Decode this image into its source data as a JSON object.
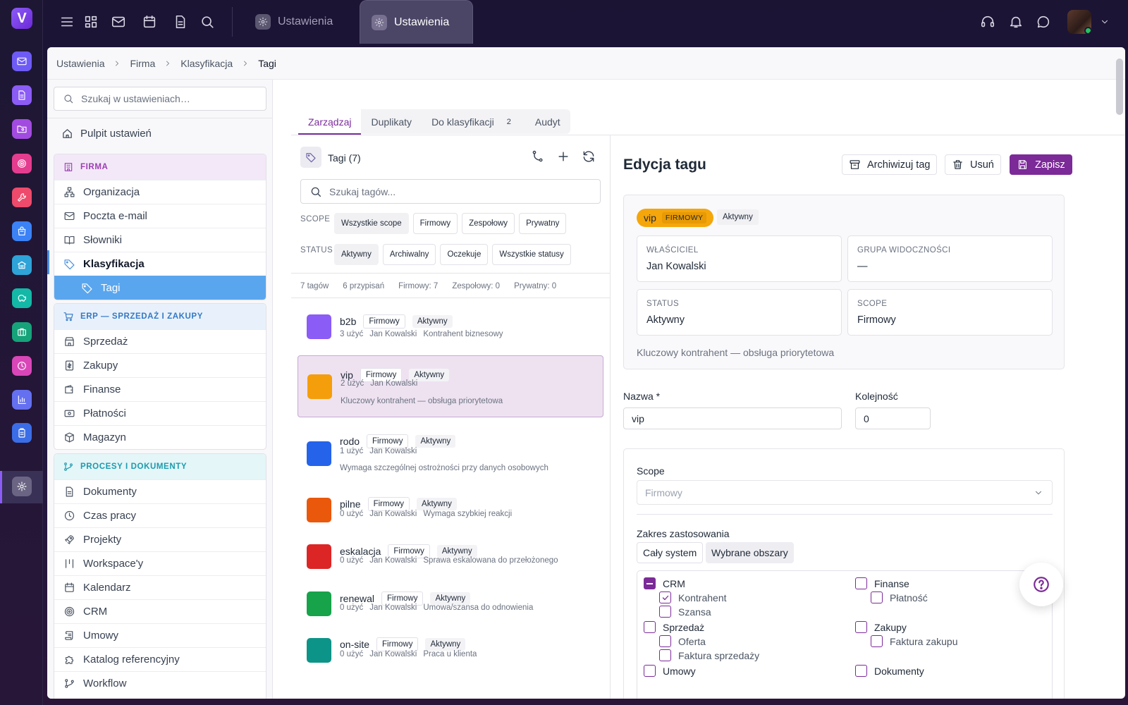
{
  "app": {
    "logo_letter": "V"
  },
  "rail": {
    "items": [
      "mail-icon",
      "document-icon",
      "folder-user-icon",
      "target-icon",
      "wrench-icon",
      "bag-icon",
      "building-icon",
      "piggy-bank-icon",
      "briefcase-icon",
      "clock-icon",
      "chart-icon",
      "clipboard-icon",
      "gear-icon"
    ],
    "colors": [
      "#6e5bf5",
      "#8b5cf6",
      "#a24be0",
      "#e43d8f",
      "#ee4a6b",
      "#3b82f6",
      "#2ea3d8",
      "#14b8a6",
      "#16a37a",
      "#d946b8",
      "#6470f0",
      "#3b6de6",
      "#6b6583"
    ]
  },
  "tabs_window": [
    {
      "label": "Ustawienia"
    },
    {
      "label": "Ustawienia"
    }
  ],
  "breadcrumb": [
    "Ustawienia",
    "Firma",
    "Klasyfikacja",
    "Tagi"
  ],
  "sidebar": {
    "search_placeholder": "Szukaj w ustawieniach…",
    "dashboard": "Pulpit ustawień",
    "groups": [
      {
        "title": "FIRMA",
        "items": [
          "Organizacja",
          "Poczta e-mail",
          "Słowniki",
          "Klasyfikacja",
          "Tagi"
        ]
      },
      {
        "title": "ERP — SPRZEDAŻ I ZAKUPY",
        "items": [
          "Sprzedaż",
          "Zakupy",
          "Finanse",
          "Płatności",
          "Magazyn"
        ]
      },
      {
        "title": "PROCESY I DOKUMENTY",
        "items": [
          "Dokumenty",
          "Czas pracy",
          "Projekty",
          "Workspace'y",
          "Kalendarz",
          "CRM",
          "Umowy",
          "Katalog referencyjny",
          "Workflow"
        ]
      }
    ]
  },
  "tabs": [
    {
      "label": "Zarządzaj"
    },
    {
      "label": "Duplikaty"
    },
    {
      "label": "Do klasyfikacji",
      "badge": "2"
    },
    {
      "label": "Audyt"
    }
  ],
  "list": {
    "title": "Tagi (7)",
    "search_placeholder": "Szukaj tagów...",
    "scope_label": "SCOPE",
    "scope_chips": [
      "Wszystkie scope",
      "Firmowy",
      "Zespołowy",
      "Prywatny"
    ],
    "status_label": "STATUS",
    "status_chips": [
      "Aktywny",
      "Archiwalny",
      "Oczekuje",
      "Wszystkie statusy"
    ],
    "stats": [
      "7 tagów",
      "6 przypisań",
      "Firmowy: 7",
      "Zespołowy: 0",
      "Prywatny: 0"
    ],
    "rows": [
      {
        "name": "b2b",
        "scope": "Firmowy",
        "status": "Aktywny",
        "uses": "3 użyć",
        "owner": "Jan Kowalski",
        "desc": "Kontrahent biznesowy",
        "color": "#8b5cf6"
      },
      {
        "name": "vip",
        "scope": "Firmowy",
        "status": "Aktywny",
        "uses": "2 użyć",
        "owner": "Jan Kowalski",
        "desc": "Kluczowy kontrahent — obsługa priorytetowa",
        "color": "#f59e0b"
      },
      {
        "name": "rodo",
        "scope": "Firmowy",
        "status": "Aktywny",
        "uses": "1 użyć",
        "owner": "Jan Kowalski",
        "desc": "Wymaga szczególnej ostrożności przy danych osobowych",
        "color": "#2563eb"
      },
      {
        "name": "pilne",
        "scope": "Firmowy",
        "status": "Aktywny",
        "uses": "0 użyć",
        "owner": "Jan Kowalski",
        "desc": "Wymaga szybkiej reakcji",
        "color": "#ea580c"
      },
      {
        "name": "eskalacja",
        "scope": "Firmowy",
        "status": "Aktywny",
        "uses": "0 użyć",
        "owner": "Jan Kowalski",
        "desc": "Sprawa eskalowana do przełożonego",
        "color": "#dc2626"
      },
      {
        "name": "renewal",
        "scope": "Firmowy",
        "status": "Aktywny",
        "uses": "0 użyć",
        "owner": "Jan Kowalski",
        "desc": "Umowa/szansa do odnowienia",
        "color": "#16a34a"
      },
      {
        "name": "on-site",
        "scope": "Firmowy",
        "status": "Aktywny",
        "uses": "0 użyć",
        "owner": "Jan Kowalski",
        "desc": "Praca u klienta",
        "color": "#0d9488"
      }
    ]
  },
  "edit": {
    "title": "Edycja tagu",
    "archive_label": "Archiwizuj tag",
    "delete_label": "Usuń",
    "save_label": "Zapisz",
    "summary": {
      "tag": "vip",
      "tag_scope": "FIRMOWY",
      "status_pill": "Aktywny",
      "owner_label": "WŁAŚCICIEL",
      "owner": "Jan Kowalski",
      "group_label": "GRUPA WIDOCZNOŚCI",
      "group": "—",
      "status_label": "STATUS",
      "status": "Aktywny",
      "scope_label": "SCOPE",
      "scope": "Firmowy",
      "description": "Kluczowy kontrahent — obsługa priorytetowa"
    },
    "name_label": "Nazwa *",
    "name_value": "vip",
    "order_label": "Kolejność",
    "order_value": "0",
    "scope_field_label": "Scope",
    "scope_field_value": "Firmowy",
    "range_label": "Zakres zastosowania",
    "range_options": [
      "Cały system",
      "Wybrane obszary"
    ],
    "tree": {
      "crm": "CRM",
      "kontrahent": "Kontrahent",
      "szansa": "Szansa",
      "sprzedaz": "Sprzedaż",
      "oferta": "Oferta",
      "faktura_sprzedazy": "Faktura sprzedaży",
      "umowy": "Umowy",
      "finanse": "Finanse",
      "platnosc": "Płatność",
      "zakupy": "Zakupy",
      "faktura_zakupu": "Faktura zakupu",
      "dokumenty": "Dokumenty"
    }
  }
}
